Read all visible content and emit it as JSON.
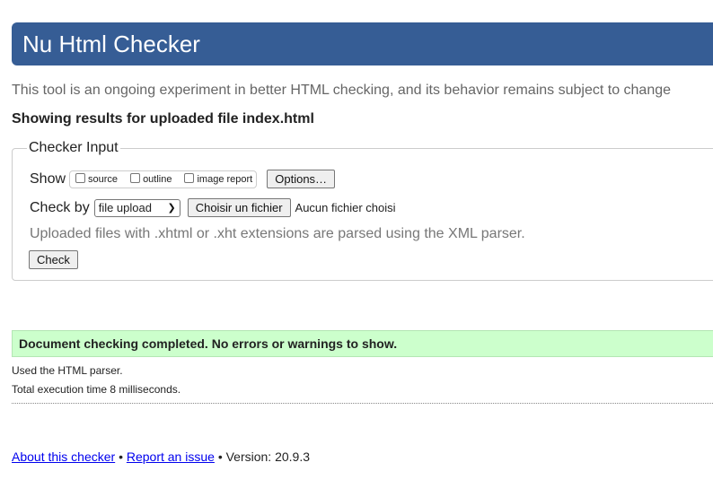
{
  "header": {
    "title": "Nu Html Checker"
  },
  "tagline": "This tool is an ongoing experiment in better HTML checking, and its behavior remains subject to change",
  "results_for": "Showing results for uploaded file index.html",
  "checker_input": {
    "legend": "Checker Input",
    "show_label": "Show",
    "show_options": [
      {
        "label": "source",
        "checked": false
      },
      {
        "label": "outline",
        "checked": false
      },
      {
        "label": "image report",
        "checked": false
      }
    ],
    "options_button": "Options…",
    "check_by_label": "Check by",
    "check_by_selected": "file upload",
    "choose_file_button": "Choisir un fichier",
    "no_file_text": "Aucun fichier choisi",
    "hint": "Uploaded files with .xhtml or .xht extensions are parsed using the XML parser.",
    "check_button": "Check"
  },
  "results": {
    "success_message": "Document checking completed. No errors or warnings to show.",
    "parser_note": "Used the HTML parser.",
    "time_note": "Total execution time 8 milliseconds."
  },
  "footer": {
    "about_link": "About this checker",
    "separator": "•",
    "report_link": "Report an issue",
    "version_text": "Version: 20.9.3"
  },
  "colors": {
    "header_bg": "#365d95",
    "success_bg": "#ccffcc",
    "link": "#0000ee"
  }
}
